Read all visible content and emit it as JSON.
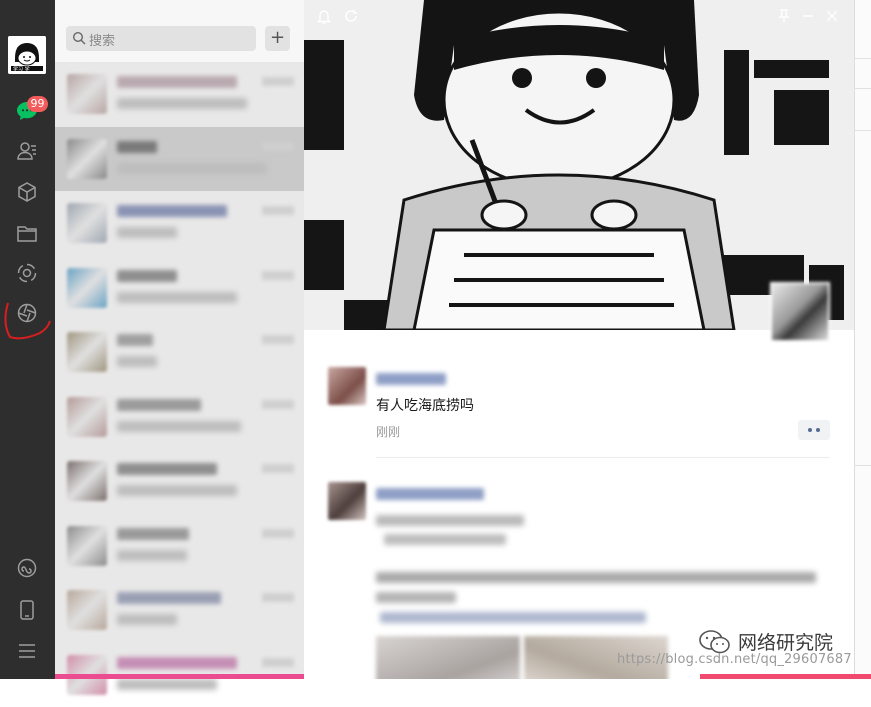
{
  "sidebar": {
    "unread_badge": "99",
    "icons": [
      "chat-icon",
      "contacts-icon",
      "favorites-icon",
      "files-icon",
      "moments-icon",
      "channels-icon",
      "mini-programs-icon",
      "phone-icon",
      "menu-icon"
    ]
  },
  "search": {
    "placeholder": "搜索",
    "add_label": "+"
  },
  "chat_list": {
    "rows": [
      {
        "selected": false,
        "avatar_color": "#b7a6a4"
      },
      {
        "selected": true,
        "avatar_color": "#8a8a8a"
      },
      {
        "selected": false,
        "avatar_color": "#9fa7b2"
      },
      {
        "selected": false,
        "avatar_color": "#6aa3c4"
      },
      {
        "selected": false,
        "avatar_color": "#a09680"
      },
      {
        "selected": false,
        "avatar_color": "#b39a98"
      },
      {
        "selected": false,
        "avatar_color": "#7a6f6c"
      },
      {
        "selected": false,
        "avatar_color": "#8c8c8c"
      },
      {
        "selected": false,
        "avatar_color": "#b8a79a"
      },
      {
        "selected": false,
        "avatar_color": "#d18ea8"
      }
    ]
  },
  "feed": {
    "post1": {
      "text": "有人吃海底捞吗",
      "time": "刚刚"
    }
  },
  "watermark": {
    "brand": "网络研究院",
    "url": "https://blog.csdn.net/qq_29607687"
  },
  "colors": {
    "rail": "#2e2e2e",
    "badge": "#f15b5b",
    "link": "#576b95"
  }
}
